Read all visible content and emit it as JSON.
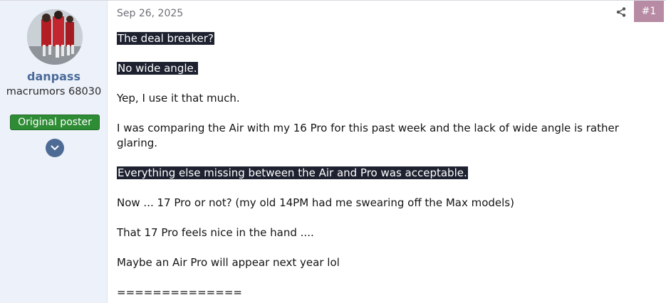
{
  "user": {
    "username": "danpass",
    "title": "macrumors 68030",
    "badge": "Original poster",
    "avatar_icon": "user-avatar-photo",
    "expand_icon": "chevron-down-icon"
  },
  "post": {
    "date": "Sep 26, 2025",
    "number": "#1",
    "share_icon": "share-icon",
    "paragraphs": [
      {
        "text": "The deal breaker?",
        "highlighted": true
      },
      {
        "text": "No wide angle.",
        "highlighted": true
      },
      {
        "text": "Yep, I use it that much.",
        "highlighted": false
      },
      {
        "text": "I was comparing the Air with my 16 Pro for this past week and the lack of wide angle is rather",
        "highlighted": false
      },
      {
        "text": "glaring.",
        "highlighted": false
      },
      {
        "text": "Everything else missing between the Air and Pro was acceptable.",
        "highlighted": true
      },
      {
        "text": "Now ... 17 Pro or not? (my old 14PM had me swearing off the Max models)",
        "highlighted": false
      },
      {
        "text": "That 17 Pro feels nice in the hand ....",
        "highlighted": false
      },
      {
        "text": "Maybe an Air Pro will appear next year lol",
        "highlighted": false
      },
      {
        "text": "==============",
        "highlighted": false
      }
    ]
  },
  "colors": {
    "sidebar_bg": "#edf1f9",
    "username": "#4a6a9a",
    "badge_bg": "#2e8c35",
    "post_number_bg": "#b88ba4",
    "highlight_bg": "#1e2230"
  }
}
